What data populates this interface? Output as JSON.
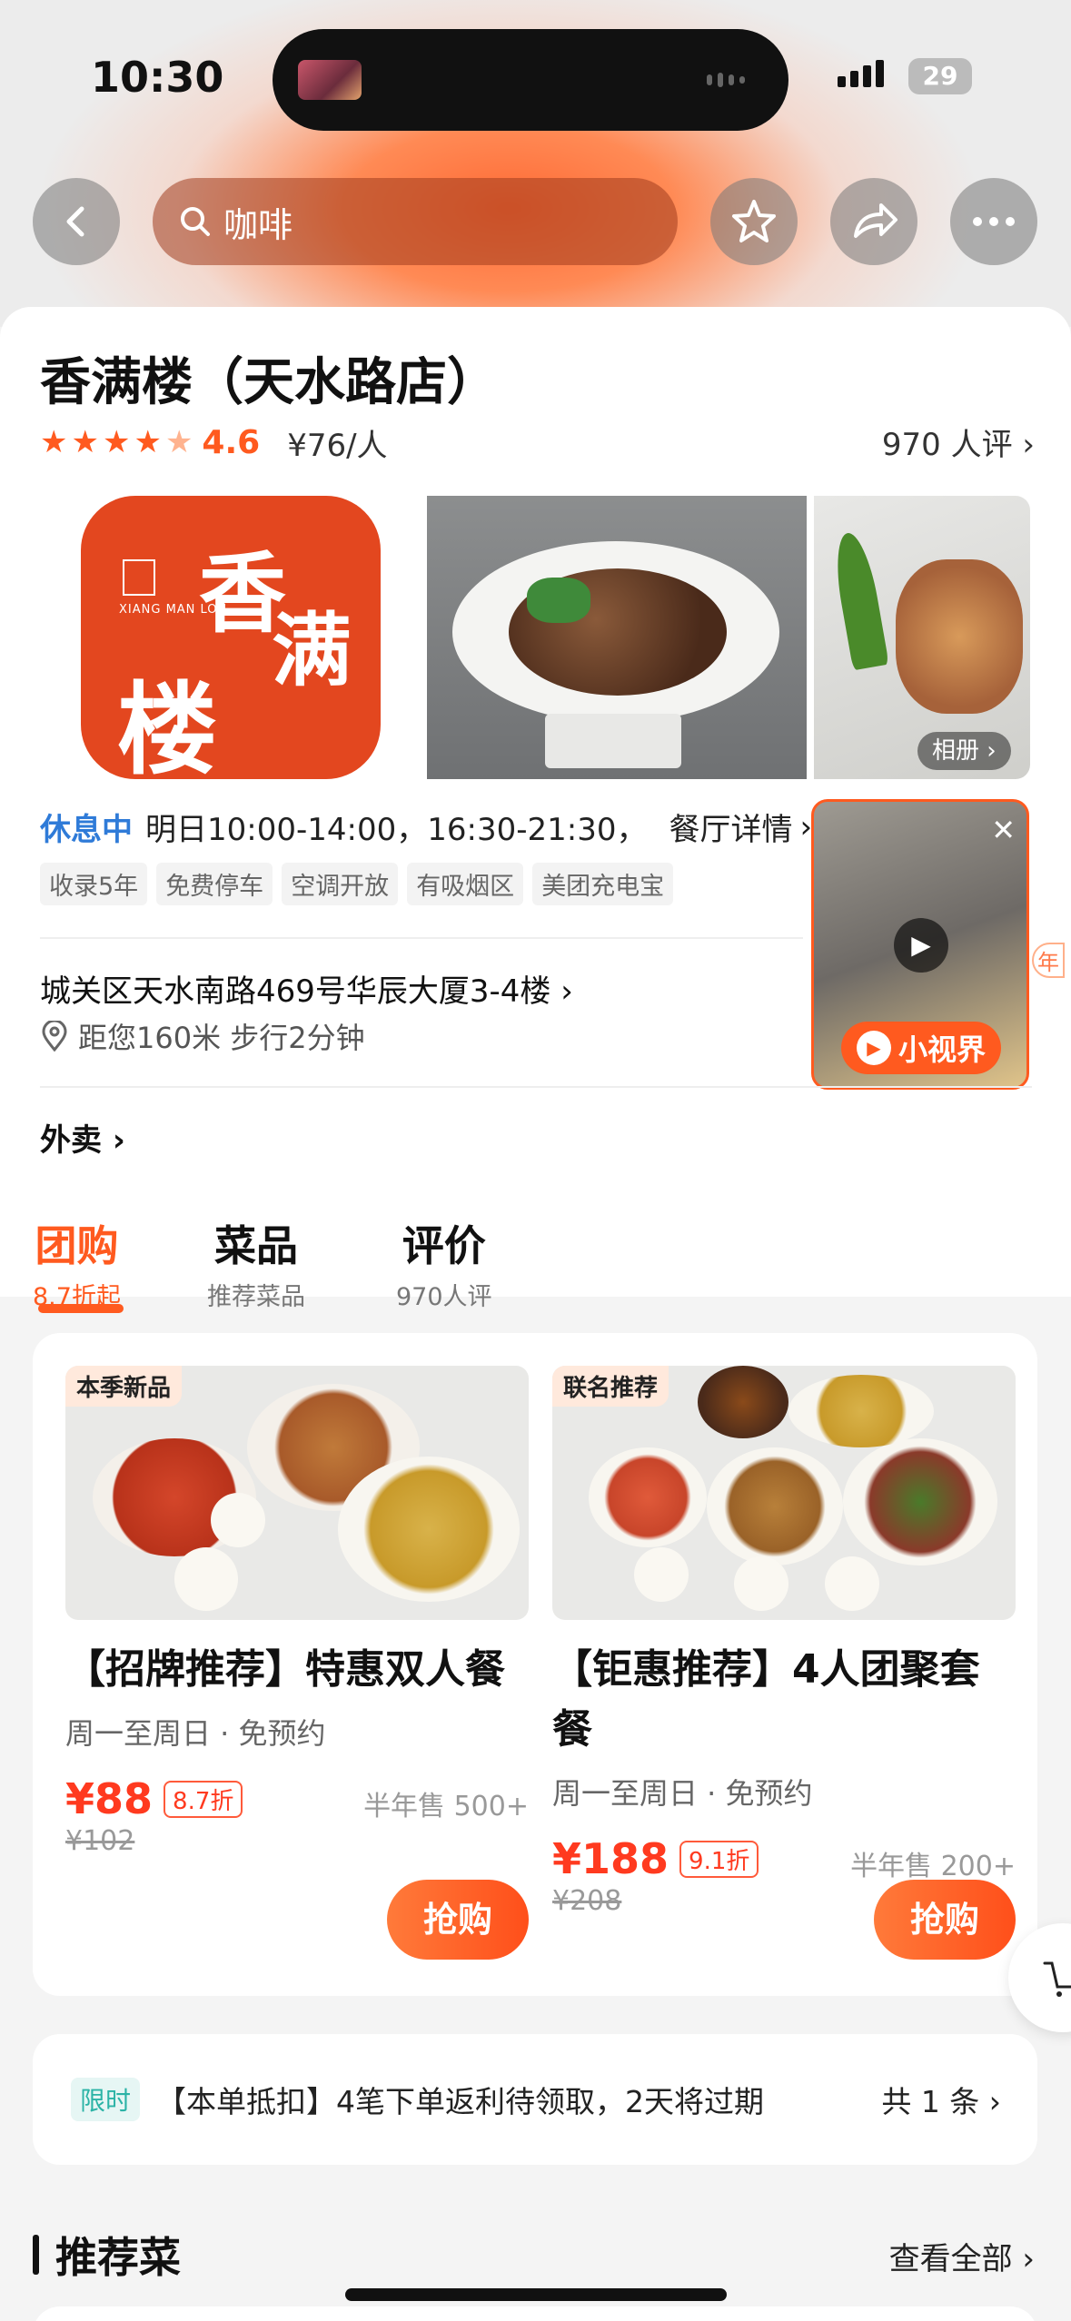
{
  "status_bar": {
    "time": "10:30",
    "battery": "29"
  },
  "nav": {
    "search_placeholder": "咖啡"
  },
  "shop": {
    "name": "香满楼（天水路店）",
    "score": "4.6",
    "price_per_person": "¥76/人",
    "reviews_link": "970 人评",
    "album_label": "相册",
    "logo_text": {
      "c1": "香",
      "c2": "满",
      "c3": "楼",
      "en": "XIANG MAN LOU"
    },
    "status": "休息中",
    "hours": "明日10:00-14:00，16:30-21:30，",
    "detail_link": "餐厅详情",
    "tags": [
      "收录5年",
      "免费停车",
      "空调开放",
      "有吸烟区",
      "美团充电宝"
    ],
    "address": "城关区天水南路469号华辰大厦3-4楼",
    "distance": "距您160米 步行2分钟",
    "takeout": "外卖"
  },
  "video": {
    "label": "小视界",
    "peek": "年"
  },
  "tabs": [
    {
      "title": "团购",
      "sub": "8.7折起"
    },
    {
      "title": "菜品",
      "sub": "推荐菜品"
    },
    {
      "title": "评价",
      "sub": "970人评"
    }
  ],
  "deals": [
    {
      "badge": "本季新品",
      "name": "【招牌推荐】特惠双人餐",
      "sub": "周一至周日 · 免预约",
      "price": "¥88",
      "discount": "8.7折",
      "sold": "半年售 500+",
      "original": "¥102",
      "buy": "抢购"
    },
    {
      "badge": "联名推荐",
      "name": "【钜惠推荐】4人团聚套餐",
      "sub": "周一至周日 · 免预约",
      "price": "¥188",
      "discount": "9.1折",
      "sold": "半年售 200+",
      "original": "¥208",
      "buy": "抢购"
    }
  ],
  "coupon": {
    "badge": "限时",
    "message": "【本单抵扣】4笔下单返利待领取，2天将过期",
    "count": "共 1 条"
  },
  "recommend": {
    "title": "推荐菜",
    "see_all": "查看全部"
  },
  "colors": {
    "accent": "#ff5a1f",
    "closed": "#2f7bd8",
    "price": "#ff3a1f"
  }
}
